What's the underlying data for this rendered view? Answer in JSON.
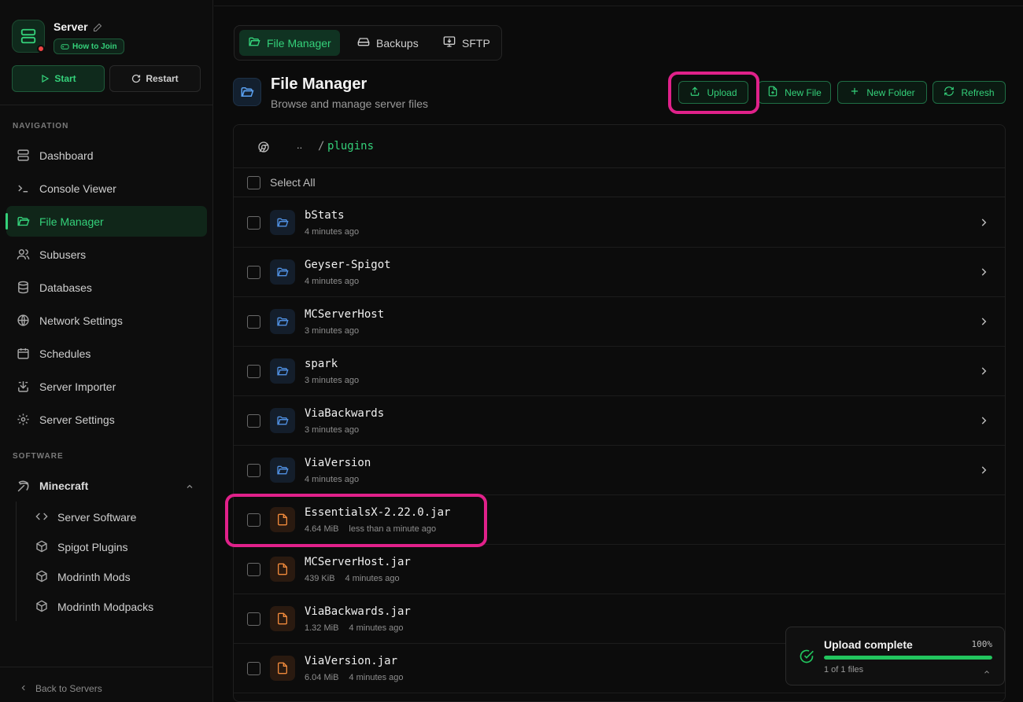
{
  "colors": {
    "accent": "#34d17a",
    "highlight": "#e0218a",
    "folder": "#4f8fe0",
    "file": "#f08a3c"
  },
  "server": {
    "name": "Server",
    "how_to_join": "How to Join",
    "start": "Start",
    "restart": "Restart"
  },
  "sidebar": {
    "nav_title": "NAVIGATION",
    "items": [
      {
        "label": "Dashboard",
        "icon": "server-icon"
      },
      {
        "label": "Console Viewer",
        "icon": "terminal-icon"
      },
      {
        "label": "File Manager",
        "icon": "folder-open-icon",
        "active": true
      },
      {
        "label": "Subusers",
        "icon": "users-icon"
      },
      {
        "label": "Databases",
        "icon": "database-icon"
      },
      {
        "label": "Network Settings",
        "icon": "globe-icon"
      },
      {
        "label": "Schedules",
        "icon": "calendar-icon"
      },
      {
        "label": "Server Importer",
        "icon": "import-icon"
      },
      {
        "label": "Server Settings",
        "icon": "gear-icon"
      }
    ],
    "software_title": "SOFTWARE",
    "minecraft": {
      "label": "Minecraft",
      "items": [
        {
          "label": "Server Software",
          "icon": "code-icon"
        },
        {
          "label": "Spigot Plugins",
          "icon": "package-icon"
        },
        {
          "label": "Modrinth Mods",
          "icon": "package-icon"
        },
        {
          "label": "Modrinth Modpacks",
          "icon": "package-icon"
        }
      ]
    },
    "back": "Back to Servers"
  },
  "tabs": [
    {
      "label": "File Manager",
      "active": true
    },
    {
      "label": "Backups"
    },
    {
      "label": "SFTP"
    }
  ],
  "header": {
    "title": "File Manager",
    "subtitle": "Browse and manage server files"
  },
  "actions": {
    "upload": "Upload",
    "new_file": "New File",
    "new_folder": "New Folder",
    "refresh": "Refresh"
  },
  "breadcrumb": {
    "up": "..",
    "separator": "/",
    "path": "plugins"
  },
  "select_all": "Select All",
  "files": [
    {
      "name": "bStats",
      "type": "folder",
      "size": "",
      "modified": "4 minutes ago"
    },
    {
      "name": "Geyser-Spigot",
      "type": "folder",
      "size": "",
      "modified": "4 minutes ago"
    },
    {
      "name": "MCServerHost",
      "type": "folder",
      "size": "",
      "modified": "3 minutes ago"
    },
    {
      "name": "spark",
      "type": "folder",
      "size": "",
      "modified": "3 minutes ago"
    },
    {
      "name": "ViaBackwards",
      "type": "folder",
      "size": "",
      "modified": "3 minutes ago"
    },
    {
      "name": "ViaVersion",
      "type": "folder",
      "size": "",
      "modified": "4 minutes ago"
    },
    {
      "name": "EssentialsX-2.22.0.jar",
      "type": "file",
      "size": "4.64 MiB",
      "modified": "less than a minute ago"
    },
    {
      "name": "MCServerHost.jar",
      "type": "file",
      "size": "439 KiB",
      "modified": "4 minutes ago"
    },
    {
      "name": "ViaBackwards.jar",
      "type": "file",
      "size": "1.32 MiB",
      "modified": "4 minutes ago"
    },
    {
      "name": "ViaVersion.jar",
      "type": "file",
      "size": "6.04 MiB",
      "modified": "4 minutes ago"
    }
  ],
  "toast": {
    "title": "Upload complete",
    "percent": "100%",
    "progress": 1.0,
    "subtitle": "1 of 1 files"
  }
}
